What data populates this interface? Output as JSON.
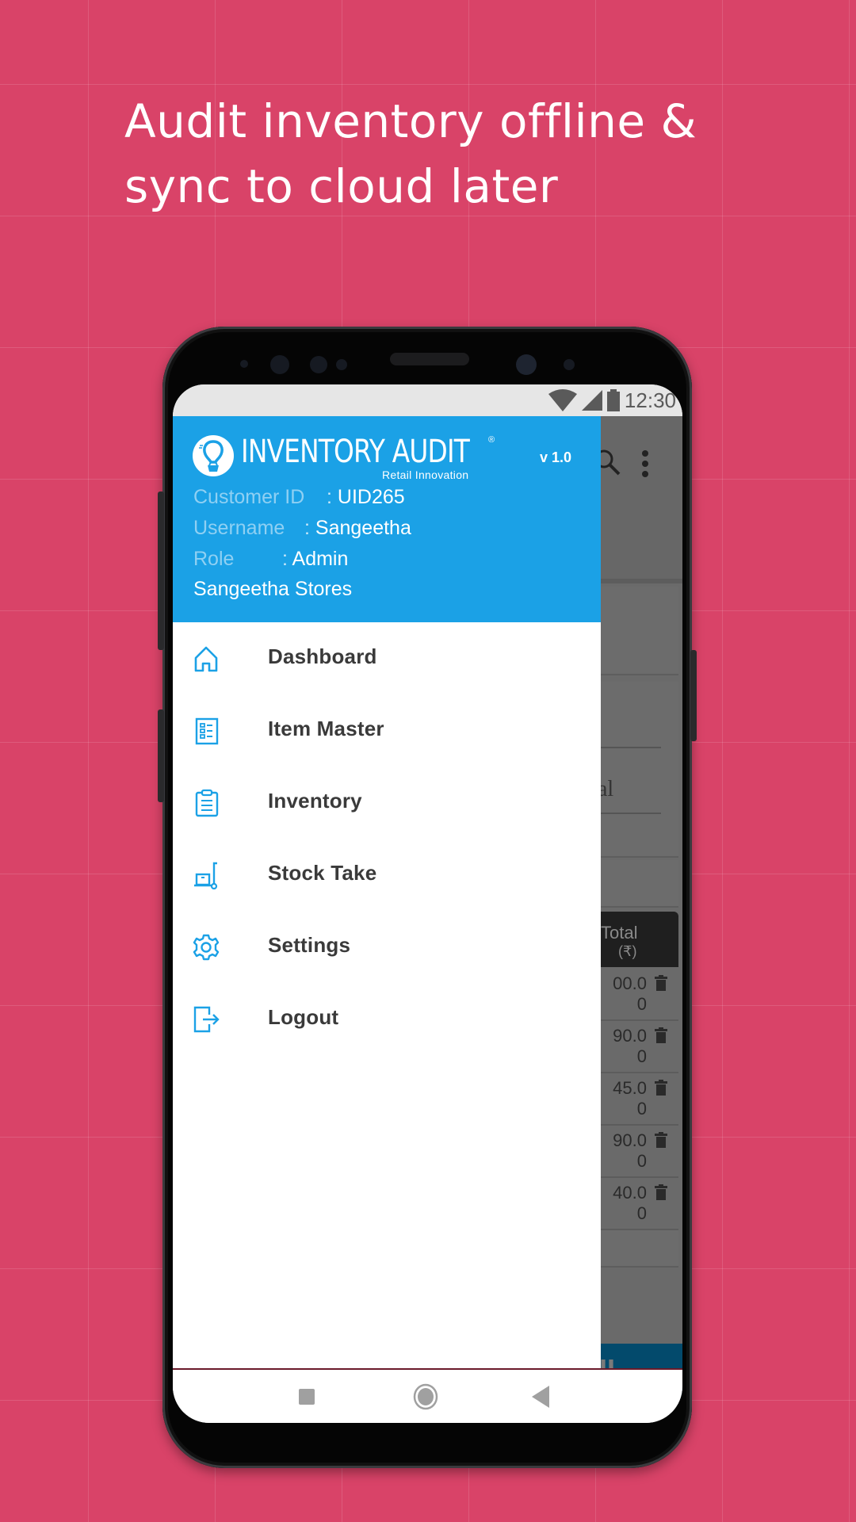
{
  "promo": {
    "headline_line1": "Audit inventory offline &",
    "headline_line2": "sync to cloud later"
  },
  "colors": {
    "background": "#d94368",
    "drawer_header": "#1ba1e6",
    "icon_accent": "#1ba1e6",
    "menu_text": "#3a3a3a",
    "bottom_button": "#034a6c"
  },
  "status_bar": {
    "time": "12:30",
    "icons": [
      "wifi-icon",
      "signal-icon",
      "battery-icon"
    ]
  },
  "drawer": {
    "brand": "INVENTORY AUDIT",
    "registered_mark": "®",
    "tagline": "Retail Innovation",
    "version": "v 1.0",
    "customer_id_label": "Customer ID",
    "customer_id_value": "UID265",
    "username_label": "Username",
    "username_value": "Sangeetha",
    "role_label": "Role",
    "role_value": "Admin",
    "separator": ":",
    "store_name": "Sangeetha Stores",
    "menu": [
      {
        "label": "Dashboard",
        "icon": "home-icon"
      },
      {
        "label": "Item Master",
        "icon": "list-icon"
      },
      {
        "label": "Inventory",
        "icon": "clipboard-icon"
      },
      {
        "label": "Stock Take",
        "icon": "hand-truck-icon"
      },
      {
        "label": "Settings",
        "icon": "gear-icon"
      },
      {
        "label": "Logout",
        "icon": "logout-icon"
      }
    ]
  },
  "background_app": {
    "field_partial_text": "al",
    "table_header": "Total",
    "table_header_unit": "(₹)",
    "rows": [
      {
        "total_line1": "00.0",
        "total_line2": "0"
      },
      {
        "total_line1": "90.0",
        "total_line2": "0"
      },
      {
        "total_line1": "45.0",
        "total_line2": "0"
      },
      {
        "total_line1": "90.0",
        "total_line2": "0"
      },
      {
        "total_line1": "40.0",
        "total_line2": "0"
      }
    ],
    "bottom_button_partial": "IL"
  }
}
